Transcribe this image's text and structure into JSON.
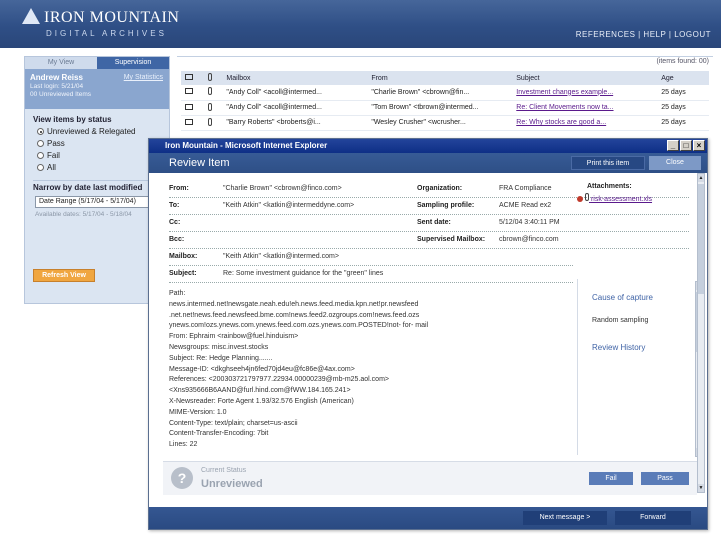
{
  "banner": {
    "brand": "IRON MOUNTAIN",
    "sub": "DIGITAL ARCHIVES",
    "links": "REFERENCES | HELP | LOGOUT"
  },
  "left": {
    "tabs": [
      "My View",
      "Supervision"
    ],
    "user": {
      "name": "Andrew Reiss",
      "stats_link": "My Statistics",
      "last_login": "Last login: 5/21/04",
      "unreviewed": "00 Unreviewed Items"
    },
    "status_title": "View items by status",
    "status_options": [
      "Unreviewed & Relegated",
      "Pass",
      "Fail",
      "All"
    ],
    "status_selected": 0,
    "date_title": "Narrow by date last modified",
    "date_value": "Date Range (5/17/04 - 5/17/04)",
    "available": "Available dates: 5/17/04 - 5/18/04",
    "refresh_label": "Refresh View"
  },
  "main": {
    "count": "(items found: 00)",
    "columns": [
      "",
      "",
      "Mailbox",
      "From",
      "Subject",
      "Age"
    ],
    "rows": [
      {
        "mailbox": "\"Andy Coll\" <acoll@intermed...",
        "from": "\"Charlie Brown\" <cbrown@fin...",
        "subject": "Investment changes example...",
        "age": "25 days"
      },
      {
        "mailbox": "\"Andy Coll\" <acoll@intermed...",
        "from": "\"Tom Brown\" <tbrown@intermed...",
        "subject": "Re: Client Movements now ta...",
        "age": "25 days"
      },
      {
        "mailbox": "\"Barry Roberts\" <broberts@i...",
        "from": "\"Wesley Crusher\" <wcrusher...",
        "subject": "Re: Why stocks are good a...",
        "age": "25 days"
      }
    ]
  },
  "popup": {
    "window_title": "Iron Mountain - Microsoft Internet Explorer",
    "win_buttons": [
      "_",
      "□",
      "×"
    ],
    "heading": "Review Item",
    "print_label": "Print this item",
    "close_label": "Close",
    "header": {
      "from_label": "From:",
      "from": "\"Charlie Brown\" <cbrown@finco.com>",
      "to_label": "To:",
      "to": "\"Keith Atkin\" <katkin@intermeddyne.com>",
      "cc_label": "Cc:",
      "cc": "",
      "bcc_label": "Bcc:",
      "bcc": "",
      "mailbox_label": "Mailbox:",
      "mailbox": "\"Keith Atkin\" <katkin@intermed.com>",
      "subject_label": "Subject:",
      "subject": "Re: Some investment guidance for the \"green\" lines",
      "org_label": "Organization:",
      "org": "FRA Compliance",
      "profile_label": "Sampling profile:",
      "profile": "ACME Read ex2",
      "sent_label": "Sent date:",
      "sent": "5/12/04 3:40:11 PM",
      "supervised_label": "Supervised Mailbox:",
      "supervised": "cbrown@finco.com"
    },
    "attachments_label": "Attachments:",
    "attachment": "risk-assessment.xls",
    "body_lines": [
      "Path:",
      "news.intermed.net!newsgate.neah.edu!eh.news.feed.media.kpn.net!pr.newsfeed",
      ".net.net!news.feed.newsfeed.bme.com!news.feed2.ozgroups.com!news.feed.ozs",
      "ynews.com!ozs.ynews.com.ynews.feed.com.ozs.ynews.com.POSTED!not- for- mail",
      "From: Ephraim <rainbow@fuel.hinduism>",
      "Newsgroups: misc.invest.stocks",
      "Subject: Re: Hedge Planning.......",
      "Message-ID: <dkghseeh4jn6fed70jd4eu@fc86e@4ax.com>",
      "References: <200303721797977.22934.00000239@mb-m25.aol.com>",
      "<Xns935666B6AAND@furl.hind.com@fWW.184.165.241>",
      "X-Newsreader: Forte Agent 1.93/32.576 English (American)",
      "MIME-Version: 1.0",
      "Content-Type: text/plain; charset=us-ascii",
      "Content-Transfer-Encoding: 7bit",
      "Lines: 22"
    ],
    "side": {
      "cause": "Cause of capture",
      "random": "Random sampling",
      "history": "Review History"
    },
    "status": {
      "label": "Current Status",
      "value": "Unreviewed",
      "fail": "Fail",
      "pass": "Pass"
    },
    "footer": {
      "next": "Next message >",
      "forward": "Forward"
    }
  },
  "colors": {
    "banner": "#2f4f86",
    "accent": "#3f66a5",
    "refresh": "#f0a640",
    "link": "#5a1a8c"
  }
}
